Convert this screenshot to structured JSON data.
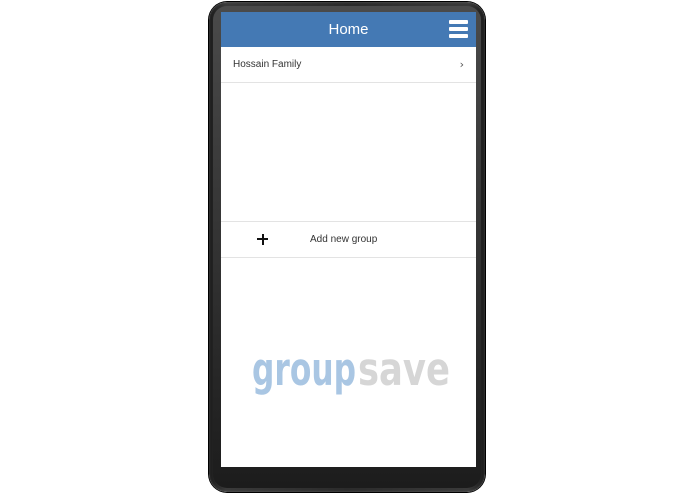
{
  "header": {
    "title": "Home",
    "menu_icon": "hamburger-menu-icon"
  },
  "groups": [
    {
      "label": "Hossain Family",
      "icon": "chevron-right-icon",
      "chevron": "›"
    }
  ],
  "add_group": {
    "label": "Add new group",
    "icon": "plus-icon"
  },
  "logo": {
    "text_part1": "group",
    "text_part2": "save"
  },
  "colors": {
    "header_bg": "#4479b4",
    "logo_group": "#a9c6e3",
    "logo_save": "#d6d6d6"
  }
}
